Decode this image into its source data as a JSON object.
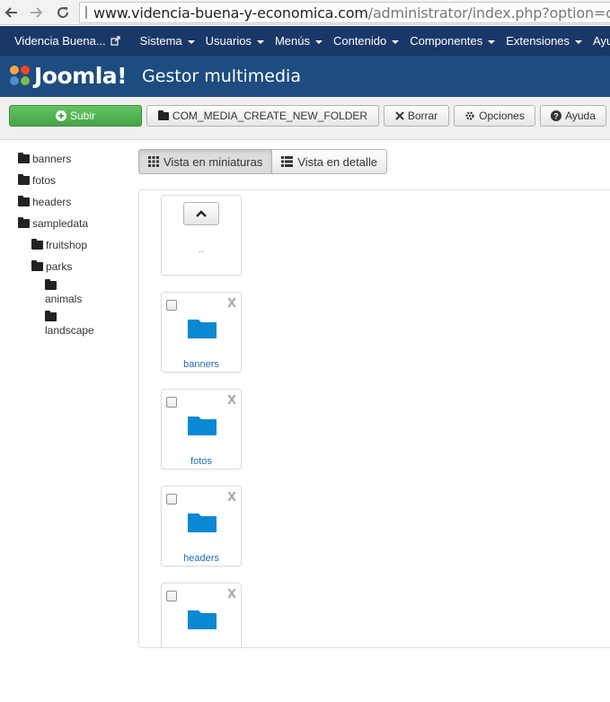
{
  "browser": {
    "url_host": "www.videncia-buena-y-economica.com",
    "url_path": "/administrator/index.php?option=com_me"
  },
  "menubar": {
    "site_label": "Videncia Buena...",
    "items": [
      "Sistema",
      "Usuarios",
      "Menús",
      "Contenido",
      "Componentes",
      "Extensiones",
      "Ayu"
    ]
  },
  "header": {
    "logo_text": "Joomla!",
    "title": "Gestor multimedia"
  },
  "toolbar": {
    "upload": "Subir",
    "create_folder": "COM_MEDIA_CREATE_NEW_FOLDER",
    "delete": "Borrar",
    "options": "Opciones",
    "help": "Ayuda"
  },
  "tree": {
    "items": [
      "banners",
      "fotos",
      "headers",
      "sampledata"
    ],
    "sampledata_children": [
      "fruitshop",
      "parks"
    ],
    "parks_children": [
      "animals",
      "landscape"
    ]
  },
  "view_toggle": {
    "thumbnails": "Vista en miniaturas",
    "detail": "Vista en detalle"
  },
  "media": {
    "parent_label": "..",
    "folders": [
      "banners",
      "fotos",
      "headers"
    ],
    "delete_glyph": "X"
  },
  "colors": {
    "menubar": "#1a3867",
    "header": "#1d4c80",
    "success": "#46a546",
    "folder_blue": "#0b88d2",
    "link": "#1f6bb5"
  }
}
